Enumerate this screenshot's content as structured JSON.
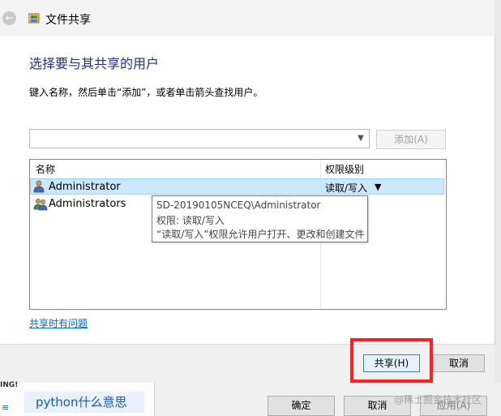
{
  "window": {
    "title": "文件共享"
  },
  "heading": "选择要与其共享的用户",
  "instruction": "键入名称，然后单击“添加”，或者单击箭头查找用户。",
  "combo": {
    "value": ""
  },
  "add_button": "添加(A)",
  "list": {
    "columns": [
      "名称",
      "权限级别"
    ],
    "rows": [
      {
        "name": "Administrator",
        "permission": "读取/写入",
        "selected": true,
        "icon": "user-icon"
      },
      {
        "name": "Administrators",
        "permission": "",
        "selected": false,
        "icon": "group-icon"
      }
    ]
  },
  "tooltip": {
    "line1": "SD-20190105NCEQ\\Administrator",
    "line2": "权限: 读取/写入",
    "line3": "“读取/写入”权限允许用户打开、更改和创建文件"
  },
  "help_link": "共享时有问题",
  "buttons": {
    "share": "共享(H)",
    "cancel": "取消"
  },
  "background": {
    "left_top_text": "ING!",
    "tab_label": "python什么意思",
    "left_icon": "≡",
    "ok": "确定",
    "cancel": "取消",
    "apply": "应用(A)",
    "watermark": "@稀土掘金技术社区"
  },
  "colors": {
    "heading": "#1e3287",
    "selection": "#cce8ff",
    "highlight": "#ff2020",
    "link": "#0066cc"
  }
}
